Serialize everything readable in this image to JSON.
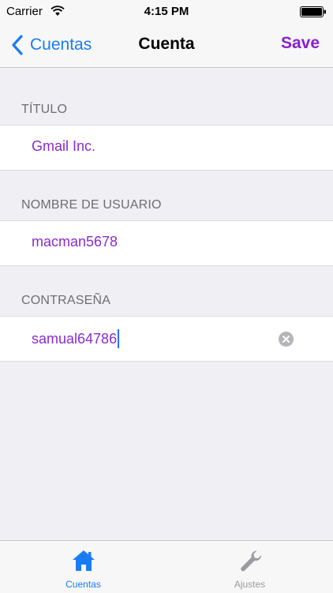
{
  "status_bar": {
    "carrier": "Carrier",
    "time": "4:15 PM"
  },
  "nav": {
    "back_label": "Cuentas",
    "title": "Cuenta",
    "save_label": "Save"
  },
  "fields": [
    {
      "header": "TÍTULO",
      "value": "Gmail Inc."
    },
    {
      "header": "NOMBRE DE USUARIO",
      "value": "macman5678"
    },
    {
      "header": "CONTRASEÑA",
      "value": "samual64786"
    }
  ],
  "tabs": [
    {
      "label": "Cuentas",
      "icon": "home-icon",
      "selected": true
    },
    {
      "label": "Ajustes",
      "icon": "wrench-icon",
      "selected": false
    }
  ],
  "colors": {
    "accent_blue": "#1a7cf4",
    "accent_purple": "#8a1fcf",
    "value_text": "#8a2bd0",
    "background": "#efeff4",
    "tab_inactive": "#9b9ba0"
  }
}
